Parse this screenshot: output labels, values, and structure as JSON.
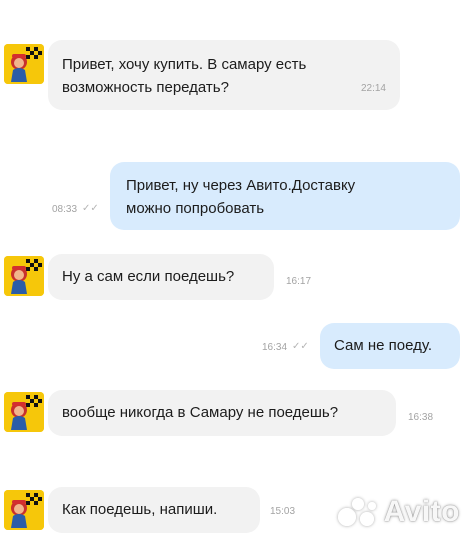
{
  "messages": [
    {
      "direction": "in",
      "lines": [
        "Привет, хочу купить. В самару есть",
        "возможность передать?"
      ],
      "time": "22:14"
    },
    {
      "direction": "out",
      "lines": [
        "Привет, ну через Авито.Доставку",
        "можно попробовать"
      ],
      "time": "08:33"
    },
    {
      "direction": "in",
      "lines": [
        "Ну а сам если поедешь?"
      ],
      "time": "16:17"
    },
    {
      "direction": "out",
      "lines": [
        "Сам не поеду."
      ],
      "time": "16:34"
    },
    {
      "direction": "in",
      "lines": [
        "вообще никогда в Самару не поедешь?"
      ],
      "time": "16:38"
    },
    {
      "direction": "in",
      "lines": [
        "Как поедешь, напиши."
      ],
      "time": "15:03"
    }
  ],
  "read_receipt": "✓✓",
  "watermark": "Avito",
  "colors": {
    "incoming_bubble": "#f2f2f2",
    "outgoing_bubble": "#d8ebfd",
    "timestamp": "#a3a3a3",
    "avatar_bg": "#f6c70a"
  }
}
